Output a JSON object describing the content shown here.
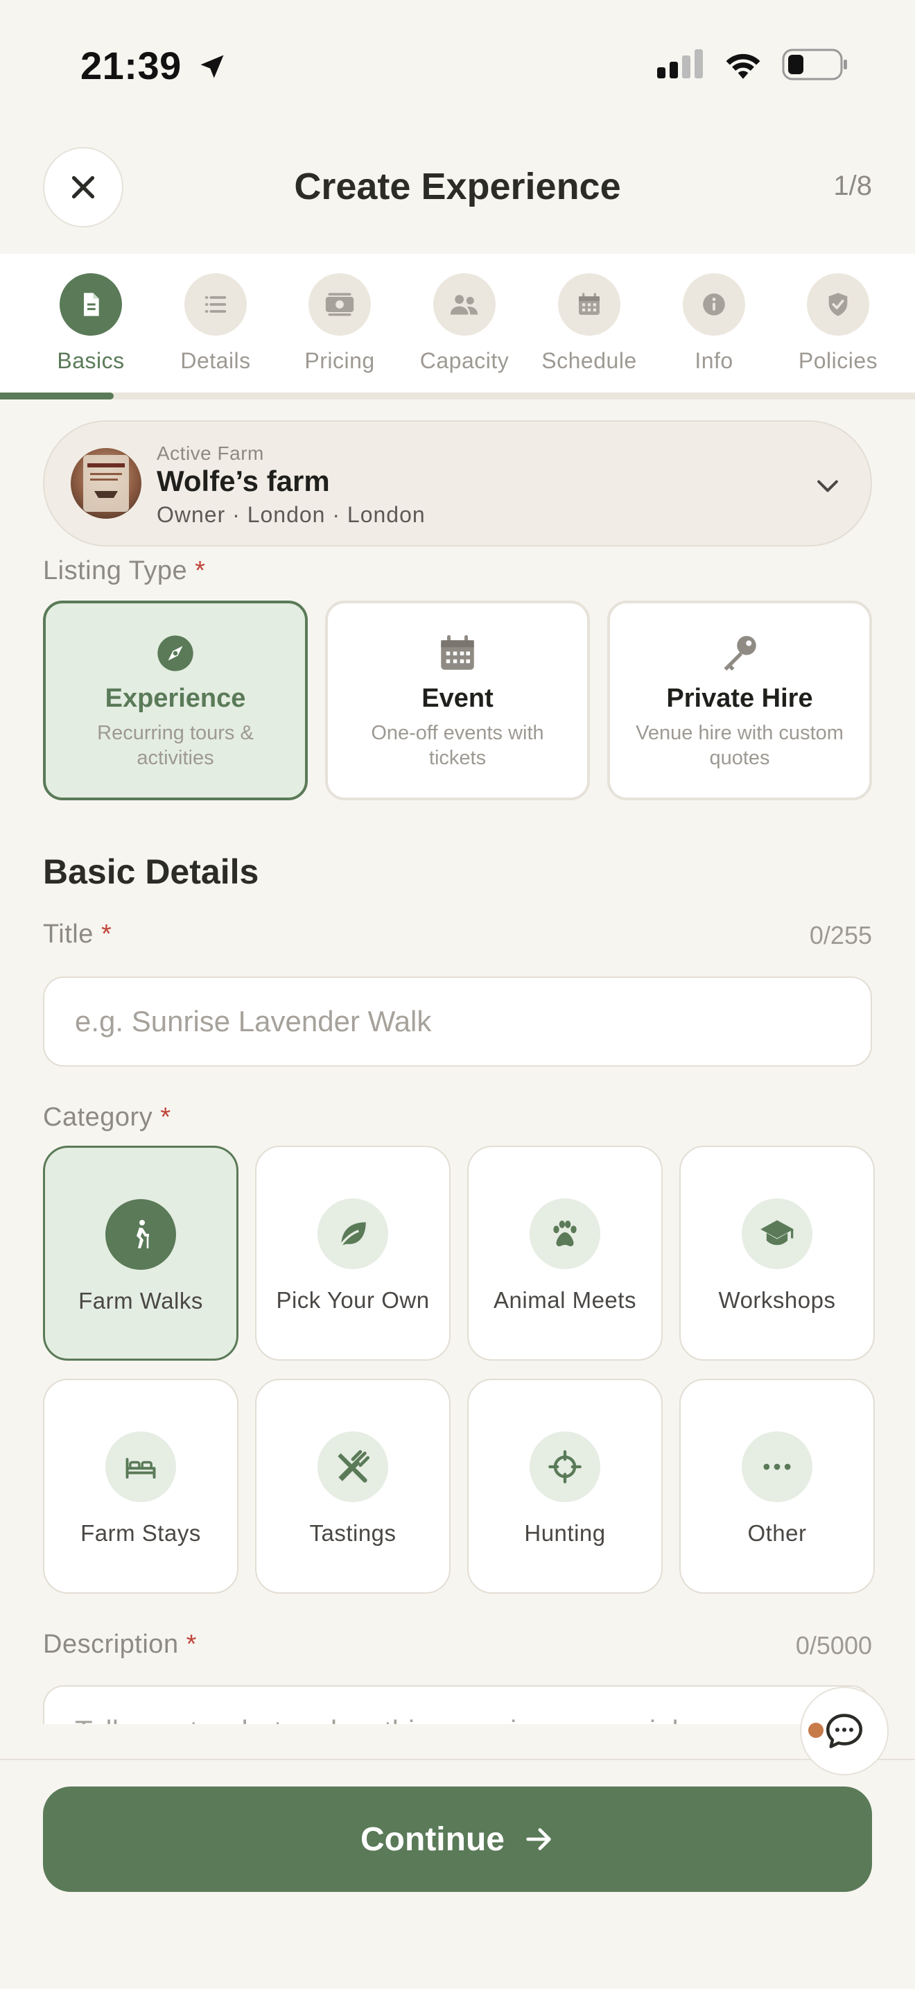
{
  "status_bar": {
    "time": "21:39"
  },
  "header": {
    "title": "Create Experience",
    "step_count": "1/8"
  },
  "steps": [
    {
      "label": "Basics",
      "icon": "document-icon"
    },
    {
      "label": "Details",
      "icon": "list-icon"
    },
    {
      "label": "Pricing",
      "icon": "banknote-icon"
    },
    {
      "label": "Capacity",
      "icon": "people-icon"
    },
    {
      "label": "Schedule",
      "icon": "calendar-icon"
    },
    {
      "label": "Info",
      "icon": "info-icon"
    },
    {
      "label": "Policies",
      "icon": "shield-check-icon"
    }
  ],
  "progress": {
    "current_step": 1,
    "total_steps": 8
  },
  "farm": {
    "caption": "Active Farm",
    "name": "Wolfe’s farm",
    "meta": "Owner · London · London"
  },
  "listing_type": {
    "label": "Listing Type",
    "required": "*",
    "selected": "Experience",
    "options": [
      {
        "title": "Experience",
        "subtitle": "Recurring tours & activities",
        "icon": "compass-icon"
      },
      {
        "title": "Event",
        "subtitle": "One-off events with tickets",
        "icon": "calendar-icon"
      },
      {
        "title": "Private Hire",
        "subtitle": "Venue hire with custom quotes",
        "icon": "key-icon"
      }
    ]
  },
  "basic_details": {
    "section_title": "Basic Details",
    "title_field": {
      "label": "Title",
      "required": "*",
      "counter": "0/255",
      "placeholder": "e.g. Sunrise Lavender Walk",
      "value": ""
    },
    "category": {
      "label": "Category",
      "required": "*",
      "selected": "Farm Walks",
      "options": [
        {
          "label": "Farm Walks",
          "icon": "hiker-icon"
        },
        {
          "label": "Pick Your Own",
          "icon": "leaf-icon"
        },
        {
          "label": "Animal Meets",
          "icon": "paw-icon"
        },
        {
          "label": "Workshops",
          "icon": "graduation-cap-icon"
        },
        {
          "label": "Farm Stays",
          "icon": "bed-icon"
        },
        {
          "label": "Tastings",
          "icon": "utensils-icon"
        },
        {
          "label": "Hunting",
          "icon": "crosshair-icon"
        },
        {
          "label": "Other",
          "icon": "ellipsis-icon"
        }
      ]
    },
    "description_field": {
      "label": "Description",
      "required": "*",
      "counter": "0/5000",
      "placeholder": "Tell guests what makes this experience special"
    }
  },
  "footer": {
    "continue_label": "Continue"
  },
  "colors": {
    "accent": "#5a7a58",
    "accent_light": "#e4ede1",
    "background": "#f7f5f0",
    "required": "#c0453a",
    "notification_dot": "#c77a4a"
  }
}
